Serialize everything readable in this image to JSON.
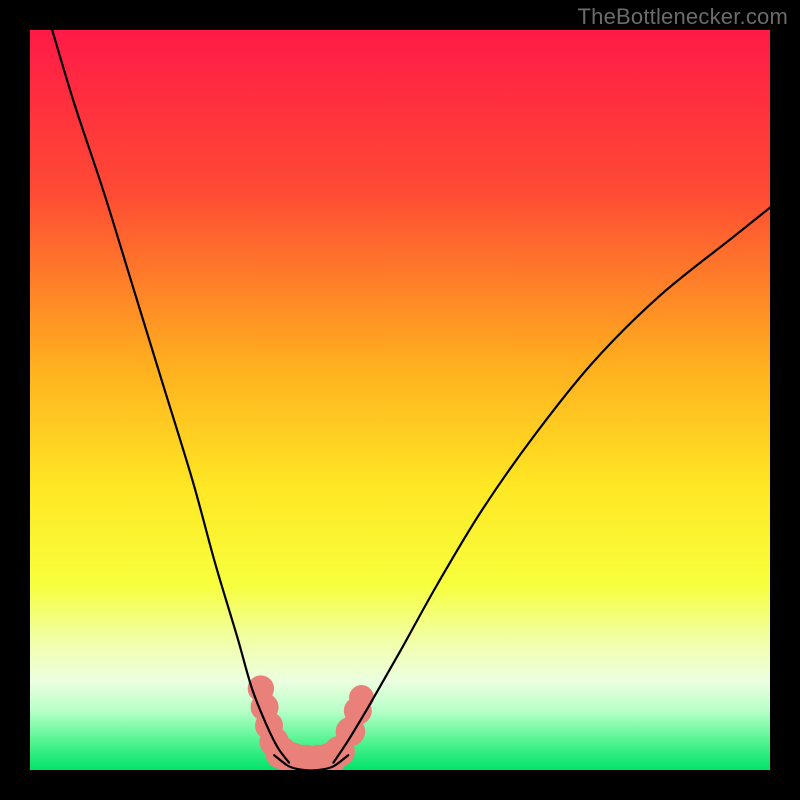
{
  "watermark": "TheBottlenecker.com",
  "chart_data": {
    "type": "line",
    "title": "",
    "xlabel": "",
    "ylabel": "",
    "xlim": [
      0,
      100
    ],
    "ylim": [
      0,
      100
    ],
    "note": "Bottleneck curve: x = relative GPU/CPU balance (arbitrary %), y = bottleneck severity (%) — 0 at optimum, rising toward 100 when mismatched. Values estimated from pixel positions; no numeric axes in source image.",
    "gradient_stops": [
      {
        "pct": 0,
        "color": "#ff1a47"
      },
      {
        "pct": 22,
        "color": "#ff4b34"
      },
      {
        "pct": 45,
        "color": "#ffae1f"
      },
      {
        "pct": 62,
        "color": "#ffe824"
      },
      {
        "pct": 75,
        "color": "#f7ff3e"
      },
      {
        "pct": 83,
        "color": "#f1ffae"
      },
      {
        "pct": 88,
        "color": "#ecffe0"
      },
      {
        "pct": 92,
        "color": "#b8ffc8"
      },
      {
        "pct": 96,
        "color": "#55f492"
      },
      {
        "pct": 100,
        "color": "#00e36a"
      }
    ],
    "series": [
      {
        "name": "left-branch",
        "x": [
          3,
          6,
          10,
          14,
          18,
          22,
          25,
          28,
          30,
          32,
          33.5,
          35
        ],
        "y": [
          100,
          90,
          78,
          65,
          52,
          39,
          28,
          18,
          11,
          6,
          3,
          1
        ]
      },
      {
        "name": "right-branch",
        "x": [
          41,
          43,
          46,
          50,
          55,
          61,
          68,
          76,
          85,
          95,
          100
        ],
        "y": [
          1,
          4,
          9,
          16,
          25,
          35,
          45,
          55,
          64,
          72,
          76
        ]
      },
      {
        "name": "valley-floor",
        "x": [
          33,
          35,
          37,
          39,
          41,
          43
        ],
        "y": [
          2,
          0.5,
          0,
          0,
          0.5,
          2
        ]
      }
    ],
    "marker_cluster": {
      "note": "Salmon rounded markers near valley (example GPU/CPU pairings).",
      "color": "#e98079",
      "points": [
        {
          "x": 31.2,
          "y": 11.0,
          "r": 1.7
        },
        {
          "x": 31.7,
          "y": 8.5,
          "r": 1.8
        },
        {
          "x": 32.3,
          "y": 6.0,
          "r": 1.8
        },
        {
          "x": 33.0,
          "y": 3.8,
          "r": 1.9
        },
        {
          "x": 34.0,
          "y": 2.3,
          "r": 2.1
        },
        {
          "x": 35.5,
          "y": 1.4,
          "r": 2.2
        },
        {
          "x": 37.3,
          "y": 1.1,
          "r": 2.2
        },
        {
          "x": 39.0,
          "y": 1.1,
          "r": 2.2
        },
        {
          "x": 40.5,
          "y": 1.5,
          "r": 2.1
        },
        {
          "x": 41.8,
          "y": 2.5,
          "r": 2.0
        },
        {
          "x": 43.3,
          "y": 5.2,
          "r": 1.9
        },
        {
          "x": 44.3,
          "y": 8.0,
          "r": 1.8
        },
        {
          "x": 44.8,
          "y": 9.8,
          "r": 1.6
        }
      ]
    }
  }
}
